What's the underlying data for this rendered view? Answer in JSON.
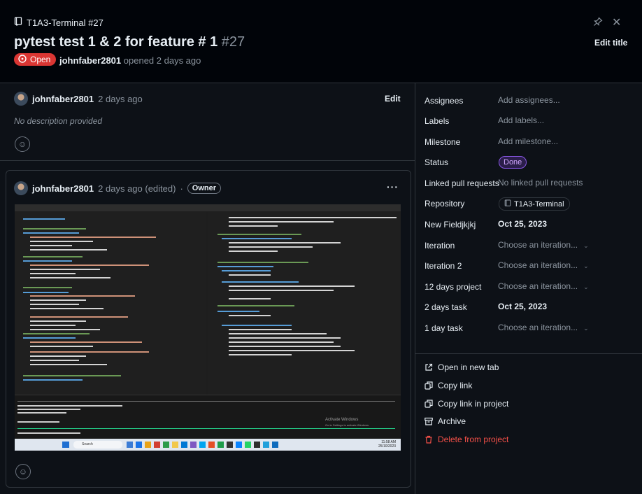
{
  "header": {
    "repo_ref": "T1A3-Terminal #27",
    "title": "pytest test 1 & 2 for feature # 1",
    "number": "#27",
    "status_badge": "Open",
    "author": "johnfaber2801",
    "opened_text": "opened 2 days ago",
    "edit_title_label": "Edit title"
  },
  "first_comment": {
    "author": "johnfaber2801",
    "time": "2 days ago",
    "edit_label": "Edit",
    "body": "No description provided"
  },
  "second_comment": {
    "author": "johnfaber2801",
    "time": "2 days ago (edited)",
    "separator": "·",
    "role_badge": "Owner",
    "more_label": "···"
  },
  "sidebar": {
    "fields": [
      {
        "label": "Assignees",
        "value": "Add assignees...",
        "style": "muted"
      },
      {
        "label": "Labels",
        "value": "Add labels...",
        "style": "muted"
      },
      {
        "label": "Milestone",
        "value": "Add milestone...",
        "style": "muted"
      },
      {
        "label": "Status",
        "value": "Done",
        "style": "badge"
      },
      {
        "label": "Linked pull requests",
        "value": "No linked pull requests",
        "style": "muted"
      },
      {
        "label": "Repository",
        "value": "T1A3-Terminal",
        "style": "chip"
      },
      {
        "label": "New Fieldjkjkj",
        "value": "Oct 25, 2023",
        "style": "strong"
      },
      {
        "label": "Iteration",
        "value": "Choose an iteration...",
        "style": "muted"
      },
      {
        "label": "Iteration 2",
        "value": "Choose an iteration...",
        "style": "muted"
      },
      {
        "label": "12 days project",
        "value": "Choose an iteration...",
        "style": "muted"
      },
      {
        "label": "2 days task",
        "value": "Oct 25, 2023",
        "style": "strong"
      },
      {
        "label": "1 day task",
        "value": "Choose an iteration...",
        "style": "muted"
      }
    ],
    "actions": [
      {
        "label": "Open in new tab"
      },
      {
        "label": "Copy link"
      },
      {
        "label": "Copy link in project"
      },
      {
        "label": "Archive"
      },
      {
        "label": "Delete from project"
      }
    ]
  },
  "screenshot": {
    "activate_windows": "Activate Windows",
    "activate_sub": "Go to Settings to activate Windows.",
    "taskbar_search": "Search",
    "taskbar_time": "11:58 AM",
    "taskbar_date": "25/10/2023"
  },
  "colors": {
    "open": "#da3633",
    "done": "#8957e5",
    "danger": "#f85149"
  }
}
